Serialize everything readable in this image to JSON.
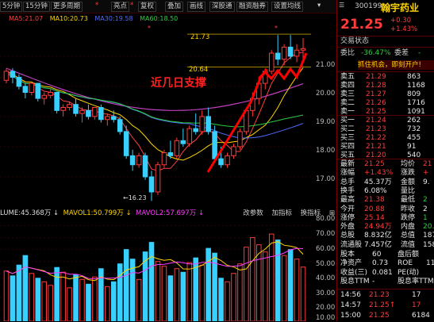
{
  "toolbar": {
    "items": [
      "5分钟",
      "15分钟",
      "更多周期",
      "亮点",
      "复权",
      "叠加",
      "画线",
      "深股通",
      "融资融券",
      "设置均线"
    ],
    "star_marks": [
      "*",
      "*",
      "*",
      "*"
    ]
  },
  "ma_legend": [
    {
      "label": "MA5:21.07",
      "color": "#ff4040"
    },
    {
      "label": "MA10:20.73",
      "color": "#ffd400"
    },
    {
      "label": "MA30:19.58",
      "color": "#4c6cff"
    },
    {
      "label": "MA60:18.50",
      "color": "#2ecc40"
    }
  ],
  "annotations": {
    "high_label": "21.73",
    "support_price": "20.64",
    "support_text": "近几日支撑",
    "low_label": "16.23"
  },
  "price_axis": [
    "21.00",
    "20.00",
    "19.00",
    "18.00",
    "17.00"
  ],
  "volume_legend": {
    "volume": "LUME:45.368万 ↓",
    "mavol1": "MAVOL1:50.799万 ↓",
    "mavol2": "MAVOL2:57.697万 ↓"
  },
  "volume_tabs": [
    "改参数",
    "加指标",
    "换指标",
    "⊞"
  ],
  "volume_axis": [
    "80.00",
    "70.00",
    "60.00",
    "50.00",
    "40.00",
    "30.00",
    "20.00",
    "10.00"
  ],
  "chart_data": {
    "type": "candlestick",
    "ylim": [
      16.0,
      22.1
    ],
    "candles": [
      [
        20.2,
        20.6,
        20.1,
        20.5
      ],
      [
        20.5,
        20.6,
        20.1,
        20.3
      ],
      [
        20.3,
        20.4,
        19.9,
        20.0
      ],
      [
        20.0,
        20.1,
        19.6,
        19.8
      ],
      [
        19.8,
        20.1,
        19.7,
        20.1
      ],
      [
        20.1,
        20.1,
        19.5,
        19.6
      ],
      [
        19.6,
        19.8,
        19.4,
        19.7
      ],
      [
        19.7,
        19.9,
        19.6,
        19.8
      ],
      [
        19.8,
        19.8,
        19.1,
        19.2
      ],
      [
        19.2,
        19.4,
        19.0,
        19.3
      ],
      [
        19.3,
        19.5,
        19.2,
        19.4
      ],
      [
        19.4,
        19.6,
        19.0,
        19.1
      ],
      [
        19.1,
        19.3,
        18.8,
        19.2
      ],
      [
        19.2,
        19.4,
        18.9,
        19.0
      ],
      [
        19.0,
        19.3,
        18.9,
        19.3
      ],
      [
        19.3,
        19.4,
        18.8,
        18.9
      ],
      [
        18.9,
        19.1,
        18.7,
        19.0
      ],
      [
        19.0,
        19.2,
        18.8,
        18.9
      ],
      [
        18.9,
        19.0,
        18.4,
        18.5
      ],
      [
        18.5,
        18.7,
        17.6,
        17.7
      ],
      [
        17.7,
        17.9,
        17.2,
        17.4
      ],
      [
        17.4,
        17.8,
        17.3,
        17.7
      ],
      [
        17.7,
        17.8,
        16.9,
        17.0
      ],
      [
        17.0,
        17.2,
        16.2,
        16.5
      ],
      [
        16.5,
        17.5,
        16.4,
        17.4
      ],
      [
        17.4,
        17.9,
        17.3,
        17.8
      ],
      [
        17.8,
        18.2,
        17.6,
        17.7
      ],
      [
        17.7,
        18.3,
        17.6,
        18.2
      ],
      [
        18.2,
        18.6,
        18.0,
        18.1
      ],
      [
        18.1,
        18.7,
        18.0,
        18.6
      ],
      [
        18.6,
        19.1,
        18.4,
        18.5
      ],
      [
        18.5,
        19.2,
        18.4,
        19.0
      ],
      [
        19.0,
        19.3,
        18.4,
        18.5
      ],
      [
        18.5,
        18.7,
        17.6,
        17.6
      ],
      [
        17.6,
        18.0,
        17.3,
        17.4
      ],
      [
        17.4,
        17.8,
        17.3,
        17.7
      ],
      [
        17.7,
        18.1,
        17.6,
        18.0
      ],
      [
        18.0,
        18.6,
        17.9,
        18.5
      ],
      [
        18.5,
        19.3,
        18.4,
        19.2
      ],
      [
        19.2,
        19.8,
        19.0,
        19.6
      ],
      [
        19.6,
        20.3,
        19.4,
        20.1
      ],
      [
        20.1,
        20.6,
        19.9,
        20.5
      ],
      [
        20.5,
        21.2,
        20.4,
        21.1
      ],
      [
        21.1,
        21.7,
        20.7,
        20.9
      ],
      [
        20.9,
        21.4,
        20.7,
        21.3
      ],
      [
        21.3,
        21.7,
        20.9,
        21.0
      ],
      [
        21.0,
        21.4,
        20.8,
        21.2
      ],
      [
        21.2,
        21.6,
        20.9,
        21.25
      ]
    ],
    "volumes": [
      42,
      38,
      47,
      55,
      40,
      36,
      33,
      30,
      45,
      41,
      28,
      39,
      35,
      31,
      37,
      44,
      29,
      33,
      48,
      60,
      52,
      35,
      58,
      66,
      50,
      46,
      38,
      44,
      41,
      49,
      53,
      47,
      61,
      57,
      36,
      33,
      40,
      48,
      62,
      70,
      64,
      58,
      73,
      68,
      55,
      60,
      52,
      45.368
    ],
    "ma_lines": [
      {
        "name": "MA5",
        "color": "#ff4040"
      },
      {
        "name": "MA10",
        "color": "#ffd400"
      },
      {
        "name": "MA30",
        "color": "#4c6cff"
      },
      {
        "name": "MA60",
        "color": "#2ecc40"
      }
    ],
    "mauve_line_color": "#c040c0"
  },
  "quote": {
    "code": "300199",
    "name": "翰宇药业",
    "price": "21.25",
    "change": "+0.30",
    "change_pct": "+1.43%",
    "section_title": "交易状态",
    "webi_label": "委比",
    "webi_value": "-36.47%",
    "weicha_label": "委差",
    "weicha_value": "-",
    "banner": "抓住机会，即刻开户!",
    "sells": [
      {
        "label": "卖五",
        "price": "21.29",
        "vol": "863"
      },
      {
        "label": "卖四",
        "price": "21.28",
        "vol": "1168"
      },
      {
        "label": "卖三",
        "price": "21.27",
        "vol": "809"
      },
      {
        "label": "卖二",
        "price": "21.26",
        "vol": "1716"
      },
      {
        "label": "卖一",
        "price": "21.25",
        "vol": "1091"
      }
    ],
    "buys": [
      {
        "label": "买一",
        "price": "21.24",
        "vol": "262"
      },
      {
        "label": "买二",
        "price": "21.23",
        "vol": "732"
      },
      {
        "label": "买三",
        "price": "21.22",
        "vol": "455"
      },
      {
        "label": "买四",
        "price": "21.21",
        "vol": "91"
      },
      {
        "label": "买五",
        "price": "21.20",
        "vol": "540"
      }
    ],
    "stats": [
      {
        "l1": "最新",
        "v1": "21.25",
        "c1": "red",
        "l2": "均价",
        "v2": "21",
        "c2": "red"
      },
      {
        "l1": "涨幅",
        "v1": "+1.43%",
        "c1": "red",
        "l2": "涨跌",
        "v2": "+",
        "c2": "red"
      },
      {
        "l1": "总手",
        "v1": "45.37万",
        "c1": "white",
        "l2": "金额",
        "v2": "9.",
        "c2": "white"
      },
      {
        "l1": "换手",
        "v1": "6.08%",
        "c1": "white",
        "l2": "量比",
        "v2": "",
        "c2": "white"
      },
      {
        "l1": "最高",
        "v1": "21.38",
        "c1": "red",
        "l2": "最低",
        "v2": "2",
        "c2": "green"
      },
      {
        "l1": "今开",
        "v1": "20.88",
        "c1": "red",
        "l2": "昨收",
        "v2": "2",
        "c2": "white"
      },
      {
        "l1": "涨停",
        "v1": "25.14",
        "c1": "red",
        "l2": "跌停",
        "v2": "1",
        "c2": "green"
      },
      {
        "l1": "外盘",
        "v1": "24.94万",
        "c1": "red",
        "l2": "内盘",
        "v2": "20.",
        "c2": "green"
      },
      {
        "l1": "总股",
        "v1": "8.832亿",
        "c1": "white",
        "l2": "总值",
        "v2": "187",
        "c2": "white"
      },
      {
        "l1": "流通股",
        "v1": "7.457亿",
        "c1": "white",
        "l2": "流值",
        "v2": "158",
        "c2": "white"
      }
    ],
    "fin": [
      {
        "l1": "股本",
        "v1": "60",
        "l2": "盘后额",
        "v2": ""
      },
      {
        "l1": "净资产",
        "v1": "0.73",
        "l2": "ROE",
        "v2": "11"
      },
      {
        "l1": "收益(三)",
        "v1": "0.081",
        "l2": "PE(动)",
        "v2": ""
      },
      {
        "l1": "股息TTM",
        "v1": "-",
        "l2": "股息率TTM",
        "v2": ""
      }
    ],
    "ticks": [
      {
        "time": "14:56",
        "price": "21.23",
        "vol": "17",
        "pc": "red",
        "vc": "white"
      },
      {
        "time": "14:57",
        "price": "21.25↑",
        "vol": "17",
        "pc": "red",
        "vc": "red"
      },
      {
        "time": "15:00",
        "price": "21.25",
        "vol": "6184",
        "pc": "red",
        "vc": "white"
      }
    ]
  }
}
